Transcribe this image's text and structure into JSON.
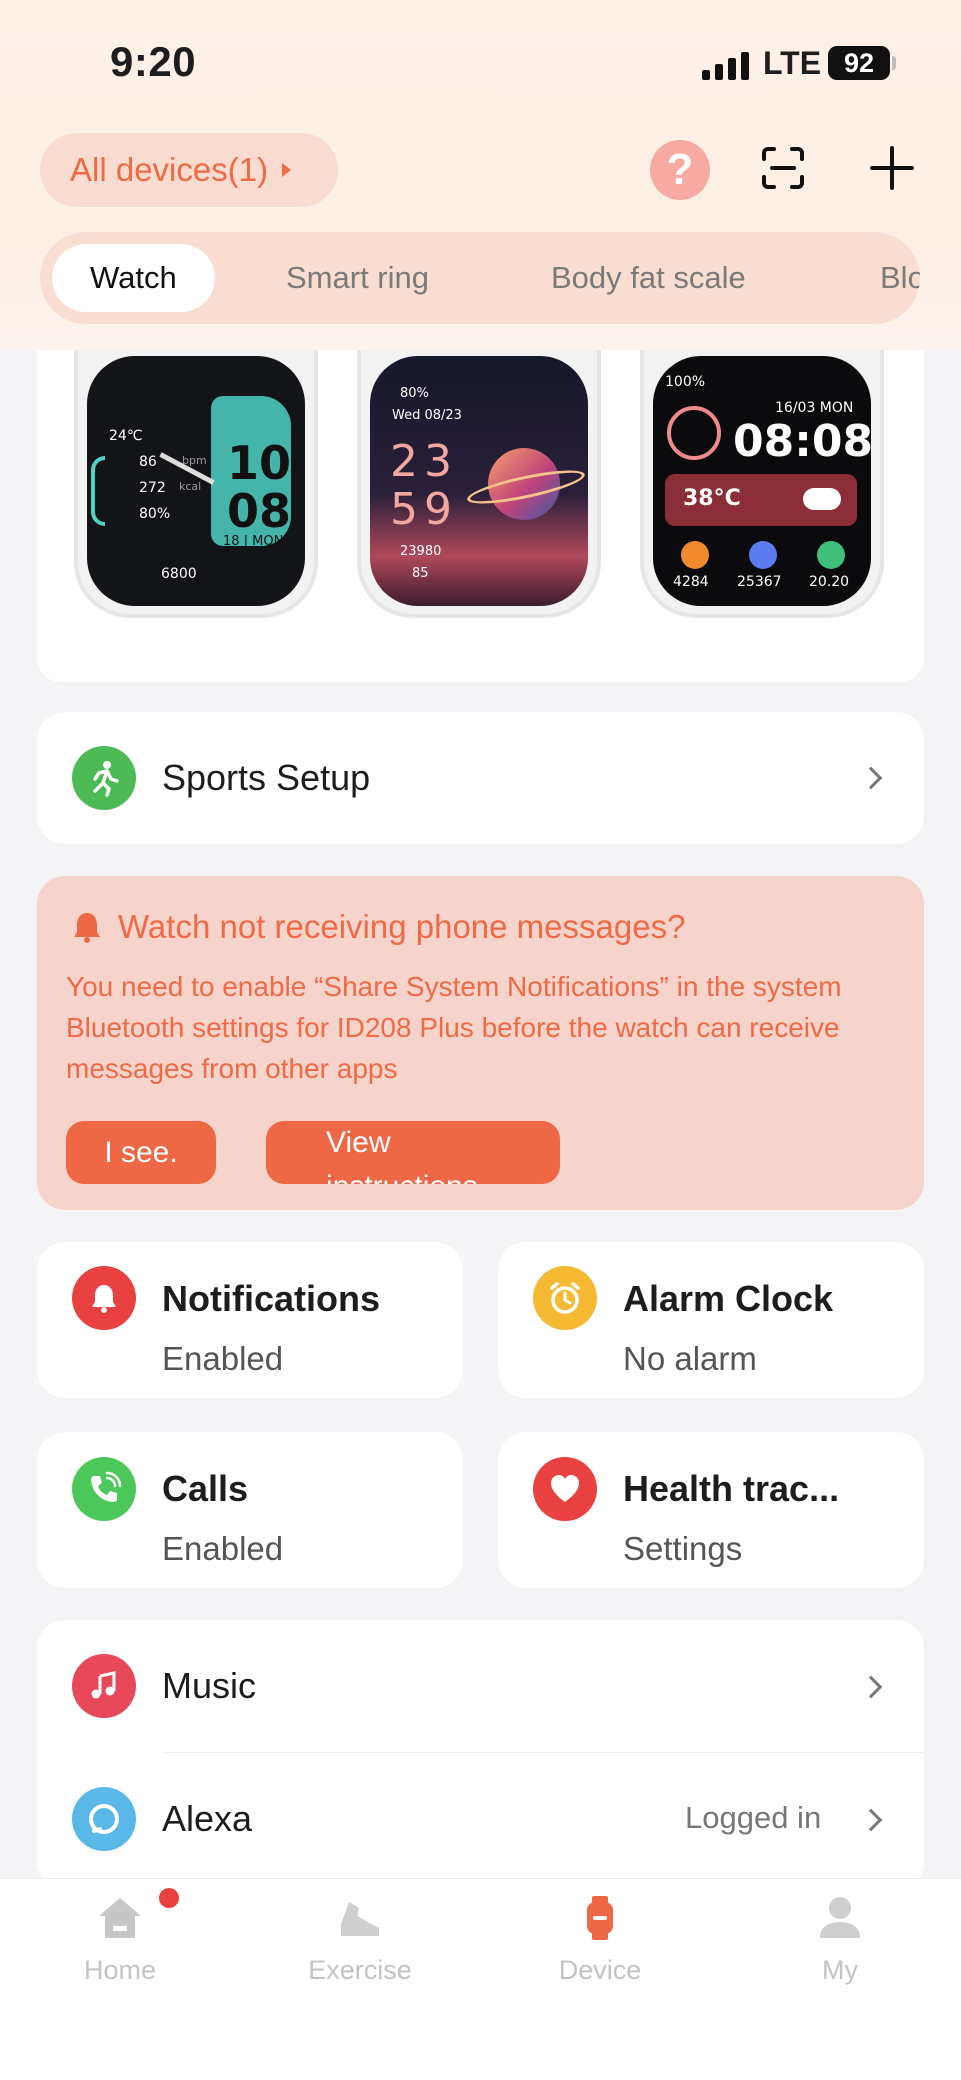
{
  "status_bar": {
    "time": "9:20",
    "network": "LTE",
    "battery": "92"
  },
  "header": {
    "devices_label": "All devices(1)",
    "help_glyph": "?"
  },
  "tabs": [
    "Watch",
    "Smart ring",
    "Body fat scale",
    "Blo"
  ],
  "watch_faces": {
    "face1": {
      "temp": "24℃",
      "heart": "86",
      "kcal_value": "272",
      "kcal_unit": "kcal",
      "battery": "80%",
      "bpm_unit": "bpm",
      "hour": "10",
      "minute": "08",
      "date": "18 | MON",
      "steps": "6800"
    },
    "face2": {
      "battery": "80%",
      "date": "Wed 08/23",
      "hour": "23",
      "minute": "59",
      "steps": "23980",
      "heart": "85"
    },
    "face3": {
      "battery": "100%",
      "date": "16/03 MON",
      "time": "08:08",
      "temp": "38°C",
      "stat1": "4284",
      "stat2": "25367",
      "stat3": "20.20"
    }
  },
  "sports_setup": {
    "label": "Sports Setup"
  },
  "warning": {
    "title": "Watch not receiving phone messages?",
    "body": "You need to enable “Share System Notifications” in the system Bluetooth settings for ID208 Plus before the watch can receive messages from other apps",
    "ok_label": "I see.",
    "instructions_label": "View instructions"
  },
  "tiles": {
    "notifications": {
      "title": "Notifications",
      "status": "Enabled"
    },
    "alarm": {
      "title": "Alarm Clock",
      "status": "No alarm"
    },
    "calls": {
      "title": "Calls",
      "status": "Enabled"
    },
    "health": {
      "title": "Health trac...",
      "status": "Settings"
    }
  },
  "list": {
    "music": {
      "label": "Music"
    },
    "alexa": {
      "label": "Alexa",
      "status": "Logged in"
    }
  },
  "nav": {
    "home": "Home",
    "exercise": "Exercise",
    "device": "Device",
    "my": "My"
  },
  "colors": {
    "accent": "#ef6845",
    "green": "#4cbb55",
    "red": "#e8413f",
    "yellow": "#f5b933",
    "blue": "#5ab8e8"
  }
}
